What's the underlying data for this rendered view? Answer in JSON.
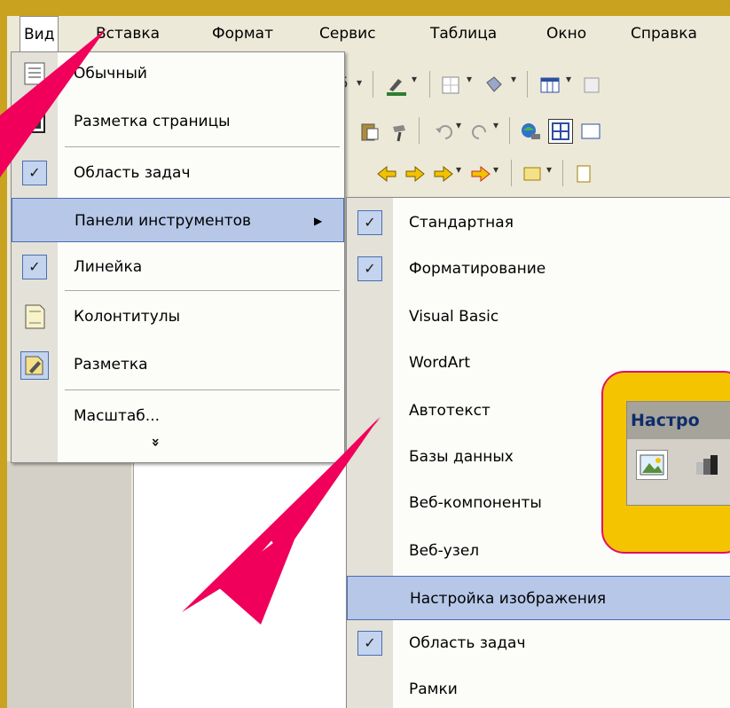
{
  "menubar": {
    "items": [
      {
        "label": "Вид"
      },
      {
        "label": "Вставка"
      },
      {
        "label": "Формат"
      },
      {
        "label": "Сервис"
      },
      {
        "label": "Таблица"
      },
      {
        "label": "Окно"
      },
      {
        "label": "Справка"
      }
    ]
  },
  "toolbar": {
    "font_size_fragment": "5"
  },
  "view_menu": {
    "items": [
      {
        "label": "Обычный",
        "icon": "normal-view-icon",
        "checked": false
      },
      {
        "label": "Разметка страницы",
        "icon": "page-layout-icon",
        "checked": false
      },
      {
        "label": "Область задач",
        "icon": "check-icon",
        "checked": true
      },
      {
        "label": "Панели инструментов",
        "icon": "submenu-arrow-icon",
        "checked": false,
        "highlighted": true
      },
      {
        "label": "Линейка",
        "icon": "check-icon",
        "checked": true
      },
      {
        "label": "Колонтитулы",
        "icon": "header-footer-icon",
        "checked": false
      },
      {
        "label": "Разметка",
        "icon": "markup-icon",
        "checked": false
      },
      {
        "label": "Масштаб...",
        "icon": "",
        "checked": false
      }
    ],
    "expand_glyph": "»"
  },
  "toolbars_submenu": {
    "items": [
      {
        "label": "Стандартная",
        "checked": true
      },
      {
        "label": "Форматирование",
        "checked": true
      },
      {
        "label": "Visual Basic",
        "checked": false
      },
      {
        "label": "WordArt",
        "checked": false
      },
      {
        "label": "Автотекст",
        "checked": false
      },
      {
        "label": "Базы данных",
        "checked": false
      },
      {
        "label": "Веб-компоненты",
        "checked": false
      },
      {
        "label": "Веб-узел",
        "checked": false
      },
      {
        "label": "Настройка изображения",
        "checked": false,
        "highlighted": true
      },
      {
        "label": "Область задач",
        "checked": true
      },
      {
        "label": "Рамки",
        "checked": false
      }
    ]
  },
  "callout": {
    "toolbar_title": "Настро"
  },
  "colors": {
    "background": "#c9a320",
    "highlight": "#b6c7e8",
    "arrow": "#f0005a",
    "callout_fill": "#f5c400",
    "callout_border": "#e0106a"
  }
}
